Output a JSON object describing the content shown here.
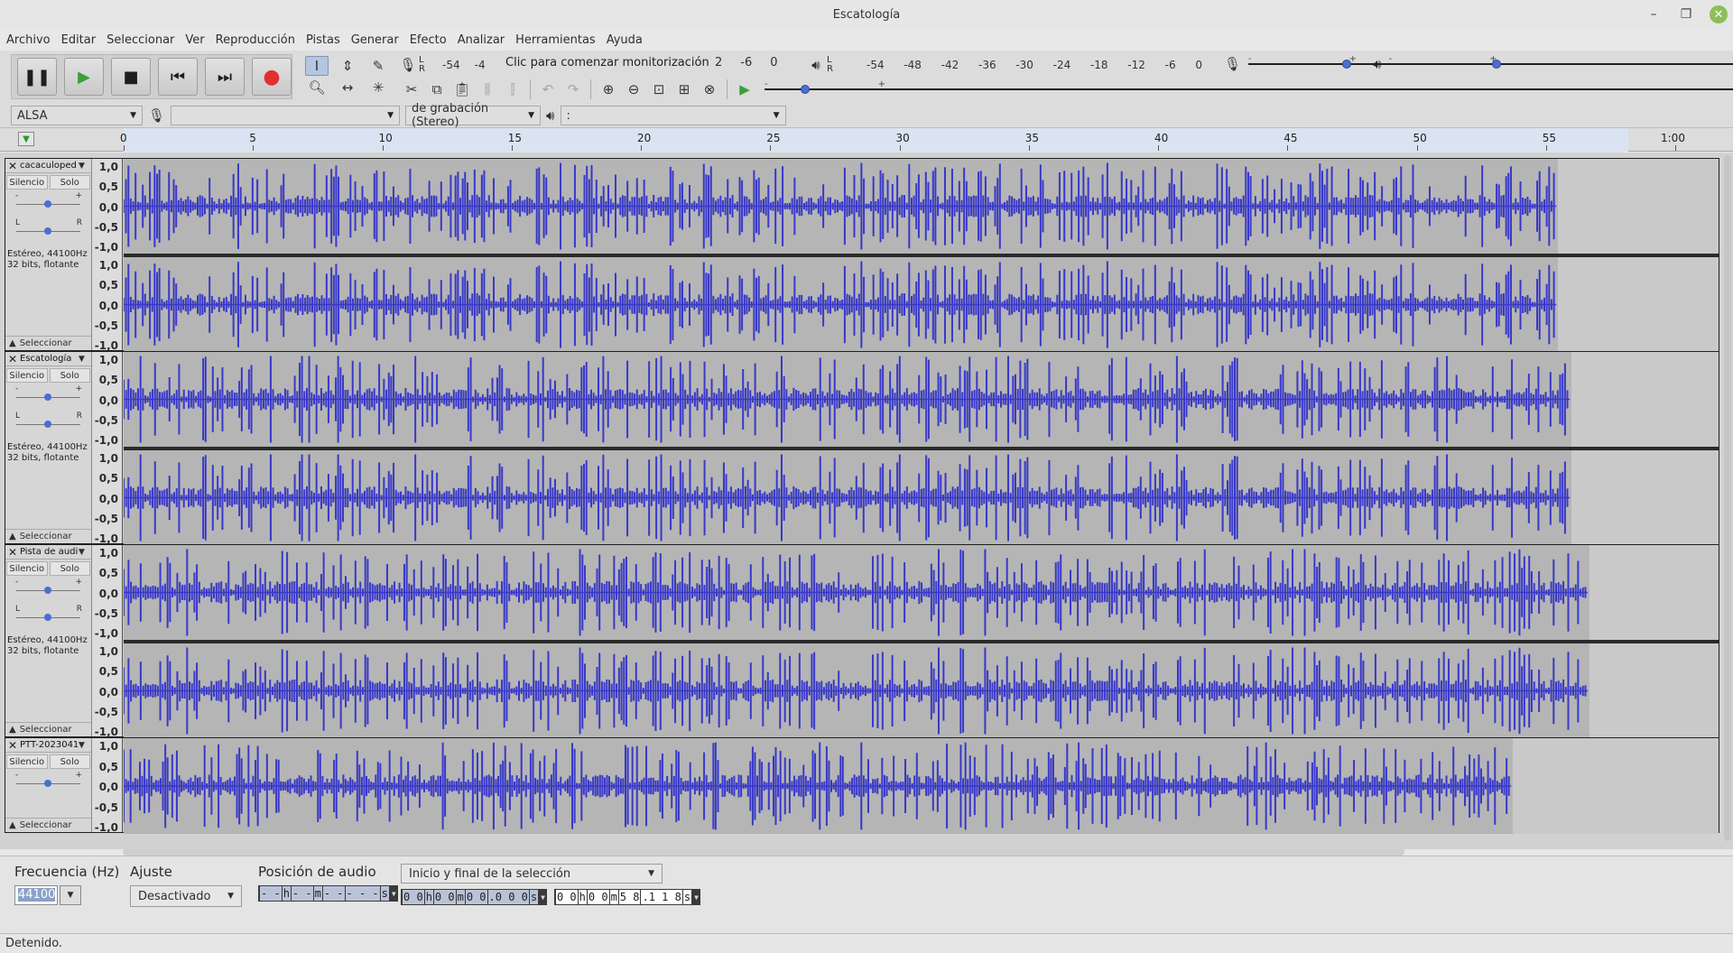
{
  "window": {
    "title": "Escatología"
  },
  "menu": [
    "Archivo",
    "Editar",
    "Seleccionar",
    "Ver",
    "Reproducción",
    "Pistas",
    "Generar",
    "Efecto",
    "Analizar",
    "Herramientas",
    "Ayuda"
  ],
  "meters": {
    "record_scale": [
      "-54",
      "-4"
    ],
    "record_hint": "Clic para comenzar monitorización",
    "record_scale_tail": [
      "2",
      "-6",
      "0"
    ],
    "playback_scale": [
      "-54",
      "-48",
      "-42",
      "-36",
      "-30",
      "-24",
      "-18",
      "-12",
      "-6",
      "0"
    ],
    "lr": [
      "L",
      "R"
    ]
  },
  "device": {
    "host": "ALSA",
    "recording_device": "",
    "channels": "de grabación (Stereo)",
    "playback_device": ":"
  },
  "ruler": {
    "labels": [
      "0",
      "5",
      "10",
      "15",
      "20",
      "25",
      "30",
      "35",
      "40",
      "45",
      "50",
      "55",
      "1:00"
    ]
  },
  "tracks": [
    {
      "name": "cacaculoped",
      "info": [
        "Estéreo, 44100Hz",
        "32 bits, flotante"
      ],
      "stereo": true
    },
    {
      "name": "Escatología",
      "info": [
        "Estéreo, 44100Hz",
        "32 bits, flotante"
      ],
      "stereo": true
    },
    {
      "name": "Pista de audio",
      "info": [
        "Estéreo, 44100Hz",
        "32 bits, flotante"
      ],
      "stereo": true
    },
    {
      "name": "PTT-2023041",
      "info": [],
      "stereo": false
    }
  ],
  "track_labels": {
    "mute": "Silencio",
    "solo": "Solo",
    "select": "Seleccionar",
    "gain_minus": "-",
    "gain_plus": "+",
    "pan_l": "L",
    "pan_r": "R"
  },
  "vruler_labels": [
    "1,0",
    "0,5",
    "0,0",
    "-0,5",
    "-1,0"
  ],
  "selection_toolbar": {
    "rate_label": "Frecuencia (Hz)",
    "rate_value": "44100",
    "snap_label": "Ajuste",
    "snap_value": "Desactivado",
    "position_label": "Posición de audio",
    "position_value": [
      "- -",
      "h",
      "- -",
      "m",
      "- -",
      "- - -",
      "s"
    ],
    "selection_mode": "Inicio y final de la selección",
    "start_value": [
      "0 0",
      "h",
      "0 0",
      "m",
      "0 0",
      ".0 0 0",
      "s"
    ],
    "end_value": [
      "0 0",
      "h",
      "0 0",
      "m",
      "5 8",
      ".1 1 8",
      "s"
    ]
  },
  "status": "Detenido.",
  "colors": {
    "waveform": "#3838c8",
    "wave_bg": "#b5b5b5",
    "ruler_selection": "#dae3f2",
    "record_button": "#e03030",
    "play_button": "#3aa03a"
  }
}
